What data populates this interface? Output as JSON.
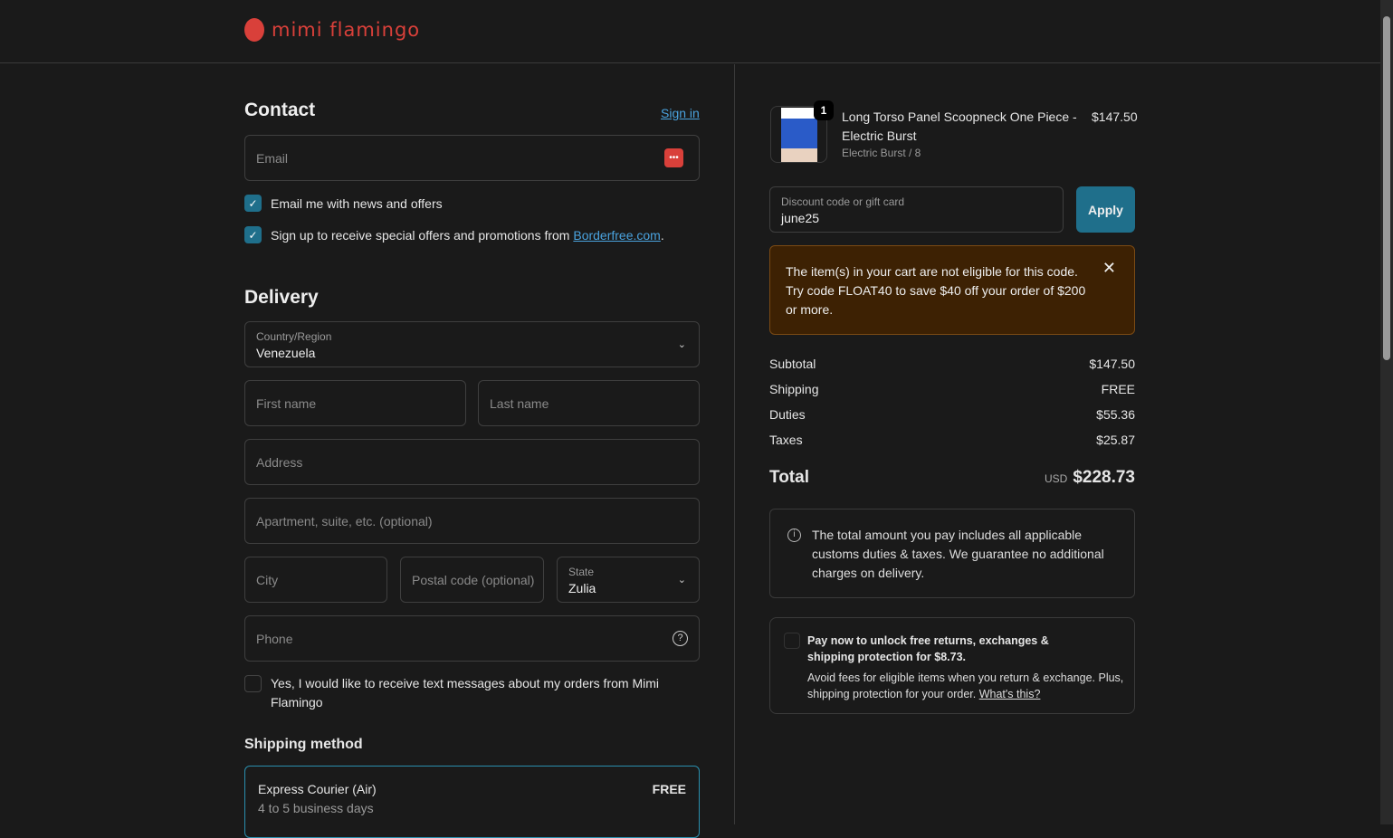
{
  "brand": {
    "name": "mimi flamingo"
  },
  "contact": {
    "title": "Contact",
    "sign_in": "Sign in",
    "email_placeholder": "Email",
    "news_label": "Email me with news and offers",
    "borderfree_prefix": "Sign up to receive special offers and promotions from ",
    "borderfree_link": "Borderfree.com",
    "borderfree_suffix": "."
  },
  "delivery": {
    "title": "Delivery",
    "country_label": "Country/Region",
    "country_value": "Venezuela",
    "first_name": "First name",
    "last_name": "Last name",
    "address": "Address",
    "apartment": "Apartment, suite, etc. (optional)",
    "city": "City",
    "postal": "Postal code (optional)",
    "state_label": "State",
    "state_value": "Zulia",
    "phone": "Phone",
    "sms_label": "Yes, I would like to receive text messages about my orders from Mimi Flamingo"
  },
  "shipping": {
    "title": "Shipping method",
    "option_name": "Express Courier (Air)",
    "option_price": "FREE",
    "option_eta": "4 to 5 business days"
  },
  "cart": {
    "qty": "1",
    "product_name": "Long Torso Panel Scoopneck One Piece - Electric Burst",
    "variant": "Electric Burst / 8",
    "price": "$147.50"
  },
  "discount": {
    "label": "Discount code or gift card",
    "value": "june25",
    "apply": "Apply",
    "error": "The item(s) in your cart are not eligible for this code. Try code FLOAT40 to save $40 off your order of $200 or more."
  },
  "summary": {
    "subtotal_label": "Subtotal",
    "subtotal": "$147.50",
    "shipping_label": "Shipping",
    "shipping": "FREE",
    "duties_label": "Duties",
    "duties": "$55.36",
    "taxes_label": "Taxes",
    "taxes": "$25.87",
    "total_label": "Total",
    "currency": "USD",
    "total": "$228.73"
  },
  "notice": {
    "text": "The total amount you pay includes all applicable customs duties & taxes. We guarantee no additional charges on delivery."
  },
  "protection": {
    "title": "Pay now to unlock free returns, exchanges & shipping protection for $8.73.",
    "body": "Avoid fees for eligible items when you return & exchange. Plus, shipping protection for your order. ",
    "link": "What's this?"
  },
  "colors": {
    "accent": "#1f6f8b",
    "error_bg": "#3d2103",
    "brand": "#d9403a"
  }
}
